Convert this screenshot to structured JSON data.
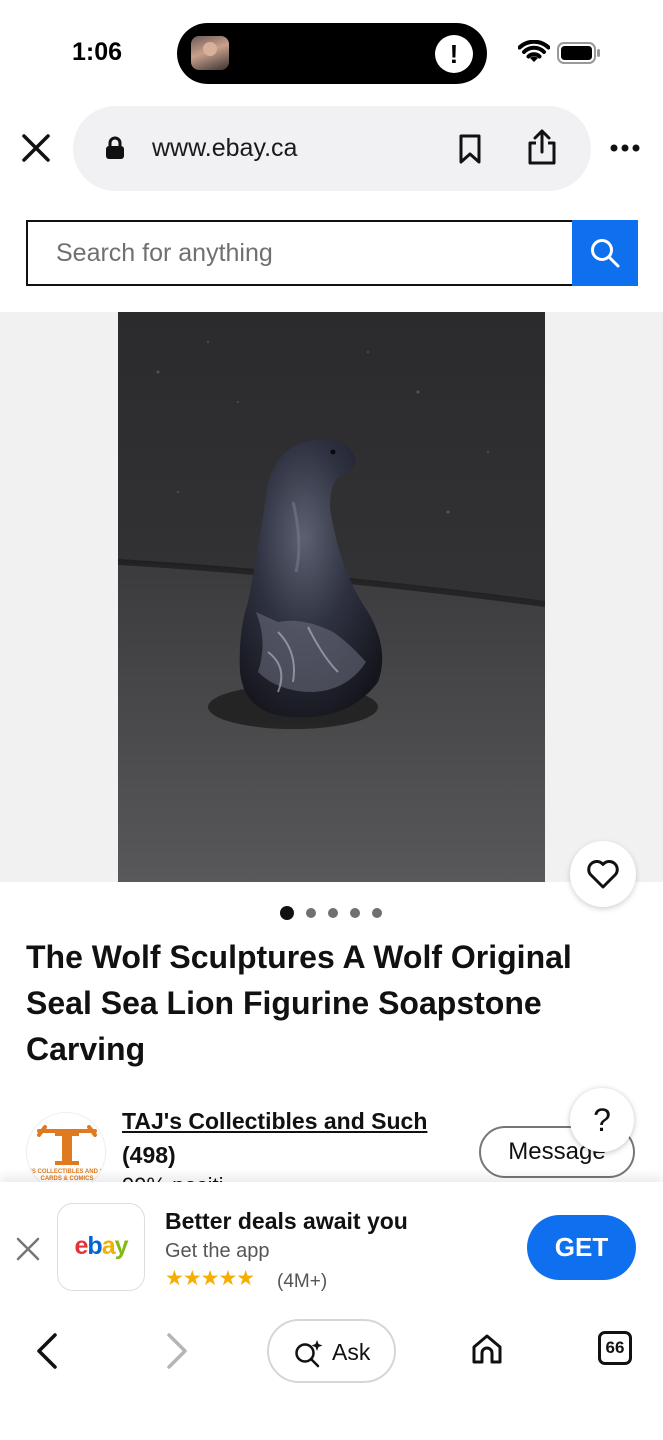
{
  "status_bar": {
    "time": "1:06",
    "alert_glyph": "!",
    "icons": [
      "avatar-thumbnail",
      "alert-icon",
      "wifi-icon",
      "battery-icon"
    ]
  },
  "browser": {
    "url": "www.ebay.ca",
    "icons": [
      "close-icon",
      "lock-icon",
      "bookmark-icon",
      "share-icon",
      "more-icon"
    ]
  },
  "search": {
    "placeholder": "Search for anything",
    "button_icon": "search-icon",
    "accent_color": "#0f70ef"
  },
  "listing": {
    "image_count": 5,
    "active_image": 1,
    "title": "The Wolf Sculptures A Wolf Original Seal Sea Lion Figurine Soapstone Carving"
  },
  "seller": {
    "name": "TAJ's Collectibles and Such",
    "feedback_count": "(498)",
    "feedback_partial": "99% positi",
    "message_label": "Message",
    "help_label": "?",
    "logo_letter": "T",
    "logo_text_line1": "'S COLLECTIBLES AND S",
    "logo_text_line2": "CARDS & COMICS",
    "logo_color": "#e07a20"
  },
  "app_banner": {
    "app_name_letters": [
      "e",
      "b",
      "a",
      "y"
    ],
    "app_name_colors": [
      "#e53238",
      "#0064d2",
      "#f5af02",
      "#86b817"
    ],
    "title": "Better deals await you",
    "subtitle": "Get the app",
    "stars": "★★★★★",
    "rating_count": "(4M+)",
    "get_label": "GET"
  },
  "toolbar": {
    "ask_label": "Ask",
    "tab_count": "66",
    "icons": [
      "back-arrow-icon",
      "forward-arrow-icon",
      "ask-sparkle-icon",
      "home-icon",
      "tabs-icon"
    ]
  }
}
